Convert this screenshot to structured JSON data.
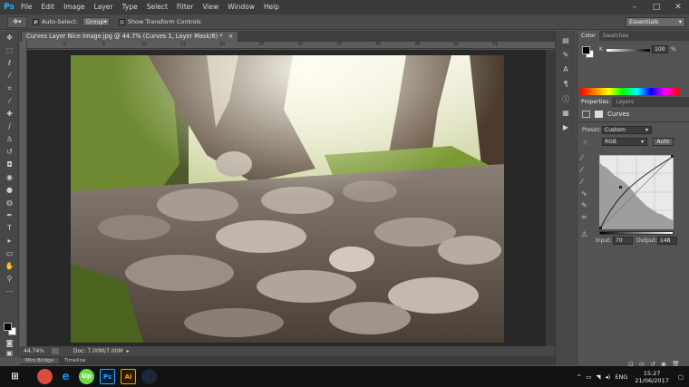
{
  "app": {
    "logo": "Ps"
  },
  "menu": [
    "File",
    "Edit",
    "Image",
    "Layer",
    "Type",
    "Select",
    "Filter",
    "View",
    "Window",
    "Help"
  ],
  "window_buttons": [
    "–",
    "□",
    "✕"
  ],
  "options_bar": {
    "auto_select_label": "Auto-Select:",
    "auto_select_value": "Group",
    "show_transform_label": "Show Transform Controls",
    "workspace": "Essentials"
  },
  "document": {
    "tab_title": "Curves Layer Nice Image.jpg @ 44.7% (Curves 1, Layer Mask/8) *",
    "tab_close": "×",
    "zoom": "44.74%",
    "doc_size": "Doc: 7.00M/7.00M",
    "ruler_ticks": [
      "0",
      "5",
      "10",
      "15",
      "20",
      "25",
      "30",
      "35",
      "40",
      "45",
      "50",
      "55"
    ]
  },
  "bottom_tabs": [
    "Mini Bridge",
    "Timeline"
  ],
  "panels": {
    "color_tabs": [
      "Color",
      "Swatches"
    ],
    "k_label": "K",
    "k_value": "100",
    "k_unit": "%",
    "props_tabs": [
      "Properties",
      "Layers"
    ],
    "props_title": "Curves",
    "preset_label": "Preset:",
    "preset_value": "Custom",
    "channel_value": "RGB",
    "auto_label": "Auto",
    "input_label": "Input:",
    "input_value": "70",
    "output_label": "Output:",
    "output_value": "148"
  },
  "taskbar": {
    "apps": [
      "Chrome",
      "Edge",
      "Upwork",
      "Ps",
      "Ai",
      "Steam"
    ],
    "app_labels": [
      "",
      "e",
      "Up",
      "Ps",
      "Ai",
      ""
    ],
    "lang": "ENG",
    "time": "15:27",
    "date": "21/06/2017"
  },
  "colors": {
    "ps_blue": "#31a8ff",
    "ai_orange": "#ff9a00",
    "chrome": "#dd4b39",
    "edge": "#1e88e5",
    "upwork": "#6fda44",
    "steam": "#1b2838"
  }
}
